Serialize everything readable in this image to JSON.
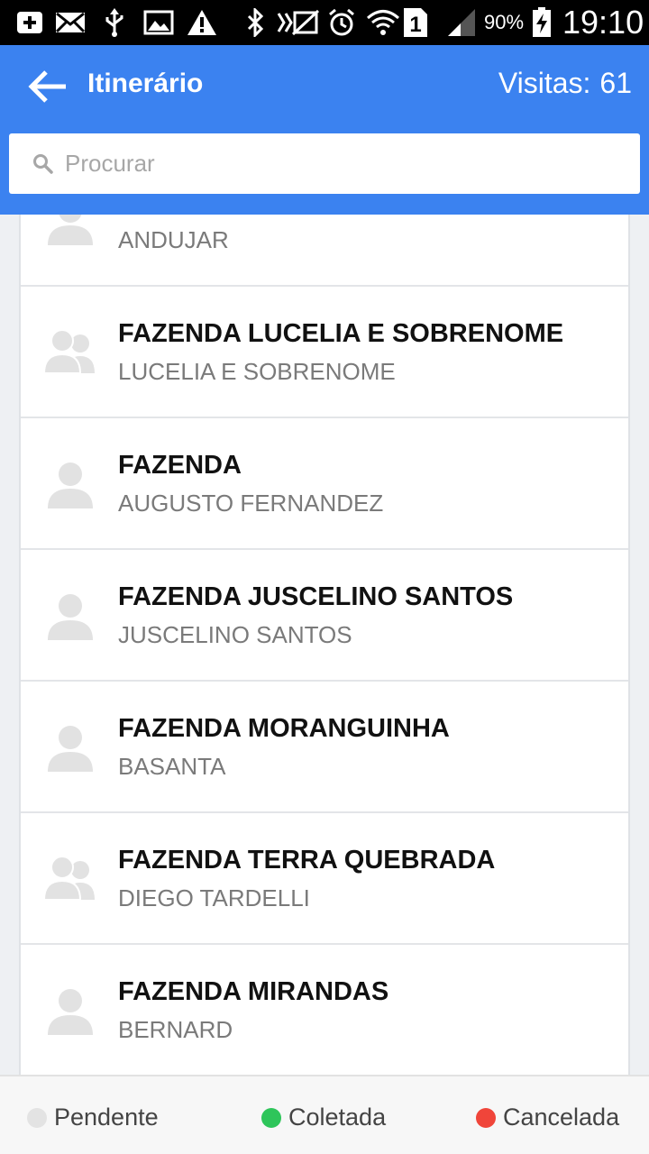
{
  "status_bar": {
    "battery_percent": "90%",
    "time": "19:10",
    "sim_slot": "1",
    "icons": [
      "add-icon",
      "mail-icon",
      "usb-icon",
      "image-icon",
      "warning-icon",
      "bluetooth-icon",
      "nfc-icon",
      "mute-icon",
      "alarm-icon",
      "wifi-icon",
      "sim-icon",
      "signal-icon",
      "battery-charging-icon"
    ]
  },
  "app_bar": {
    "title": "Itinerário",
    "visits_label": "Visitas:",
    "visits_count": "61",
    "color": "#3b82f0"
  },
  "search": {
    "placeholder": "Procurar",
    "value": ""
  },
  "list": {
    "items": [
      {
        "name": "",
        "subtitle": "ANDUJAR",
        "avatar": "single-person-icon"
      },
      {
        "name": "FAZENDA LUCELIA E SOBRENOME",
        "subtitle": "LUCELIA E SOBRENOME",
        "avatar": "group-people-icon"
      },
      {
        "name": "FAZENDA",
        "subtitle": "AUGUSTO FERNANDEZ",
        "avatar": "single-person-icon"
      },
      {
        "name": "FAZENDA JUSCELINO SANTOS",
        "subtitle": "JUSCELINO SANTOS",
        "avatar": "single-person-icon"
      },
      {
        "name": "FAZENDA MORANGUINHA",
        "subtitle": "BASANTA",
        "avatar": "single-person-icon"
      },
      {
        "name": "FAZENDA TERRA QUEBRADA",
        "subtitle": "DIEGO TARDELLI",
        "avatar": "group-people-icon"
      },
      {
        "name": "FAZENDA MIRANDAS",
        "subtitle": "BERNARD",
        "avatar": "single-person-icon"
      }
    ]
  },
  "legend": {
    "pending": {
      "label": "Pendente",
      "color": "#e3e3e3"
    },
    "collected": {
      "label": "Coletada",
      "color": "#2ec55a"
    },
    "cancelled": {
      "label": "Cancelada",
      "color": "#f0453a"
    }
  }
}
